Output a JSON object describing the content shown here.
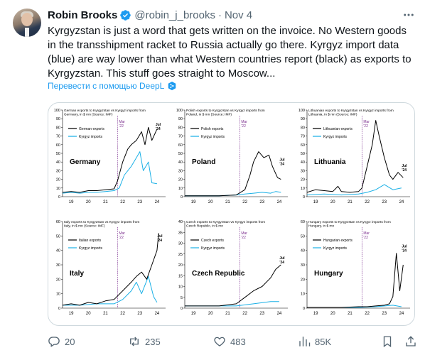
{
  "tweet": {
    "author_name": "Robin Brooks",
    "handle": "@robin_j_brooks",
    "separator": "·",
    "date": "Nov 4",
    "text": "Kyrgyzstan is just a word that gets written on the invoice. No Western goods in the transshipment racket to Russia actually go there. Kyrgyz import data (blue) are way lower than what Western countries report (black) as exports to Kyrgyzstan. This stuff goes straight to Moscow...",
    "translate_link": "Перевести с помощью DeepL",
    "stats": {
      "replies": "20",
      "reposts": "235",
      "likes": "483",
      "views": "85K"
    },
    "colors": {
      "verified": "#1d9bf0",
      "link": "#1d9bf0",
      "muted": "#536471",
      "exports_line": "#000000",
      "imports_line": "#1ab0e6",
      "marker_line": "#7b2d8e"
    }
  },
  "chart_data": [
    {
      "type": "line",
      "title": "German exports to Kyrgyzstan vs Kyrgyz imports from Germany, in $ mn (Source: IMF)",
      "country": "Germany",
      "annotation": "Jul '24",
      "marker_label": "Mar '22",
      "ylim": [
        0,
        100
      ],
      "yticks": [
        0,
        10,
        20,
        30,
        40,
        50,
        60,
        70,
        80,
        90,
        100
      ],
      "xlim": [
        19,
        25
      ],
      "xticks": [
        "19",
        "20",
        "21",
        "22",
        "23",
        "24"
      ],
      "series": [
        {
          "name": "German exports",
          "x": [
            19,
            19.5,
            20,
            20.5,
            21,
            21.5,
            22,
            22.2,
            22.5,
            22.8,
            23,
            23.3,
            23.6,
            23.8,
            24,
            24.2,
            24.5
          ],
          "values": [
            5,
            6,
            5,
            7,
            7,
            8,
            9,
            18,
            40,
            55,
            60,
            65,
            75,
            60,
            80,
            65,
            78
          ]
        },
        {
          "name": "Kyrgyz imports",
          "x": [
            19,
            19.5,
            20,
            20.5,
            21,
            21.5,
            22,
            22.3,
            22.6,
            23,
            23.3,
            23.5,
            23.7,
            24,
            24.2,
            24.5
          ],
          "values": [
            4,
            5,
            4,
            5,
            5,
            6,
            7,
            10,
            25,
            35,
            45,
            52,
            30,
            40,
            16,
            15
          ]
        }
      ]
    },
    {
      "type": "line",
      "title": "Polish exports to Kyrgyzstan vs Kyrgyz imports from Poland, in $ mn (Source: IMF)",
      "country": "Poland",
      "annotation": "Jul '24",
      "marker_label": "Mar '22",
      "ylim": [
        0,
        100
      ],
      "yticks": [
        0,
        10,
        20,
        30,
        40,
        50,
        60,
        70,
        80,
        90,
        100
      ],
      "xlim": [
        19,
        25
      ],
      "xticks": [
        "19",
        "20",
        "21",
        "22",
        "23",
        "24"
      ],
      "series": [
        {
          "name": "Polish exports",
          "x": [
            19,
            20,
            21,
            22,
            22.5,
            22.8,
            23,
            23.3,
            23.6,
            23.9,
            24.1,
            24.4,
            24.6
          ],
          "values": [
            1,
            1,
            1,
            2,
            8,
            25,
            40,
            52,
            45,
            48,
            35,
            22,
            20
          ]
        },
        {
          "name": "Kyrgyz imports",
          "x": [
            19,
            20,
            21,
            22,
            22.5,
            23,
            23.5,
            24,
            24.3,
            24.6
          ],
          "values": [
            1,
            1,
            1,
            2,
            3,
            4,
            5,
            4,
            6,
            5
          ]
        }
      ]
    },
    {
      "type": "line",
      "title": "Lithuanian exports to Kyrgyzstan vs Kyrgyz imports from Lithuania, in $ mn (Source: IMF)",
      "country": "Lithuania",
      "annotation": "Jul '24",
      "marker_label": "Mar '22",
      "ylim": [
        0,
        100
      ],
      "yticks": [
        0,
        10,
        20,
        30,
        40,
        50,
        60,
        70,
        80,
        90,
        100
      ],
      "xlim": [
        19,
        25
      ],
      "xticks": [
        "19",
        "20",
        "21",
        "22",
        "23",
        "24"
      ],
      "series": [
        {
          "name": "Lithuanian exports",
          "x": [
            19,
            19.5,
            20,
            20.5,
            20.8,
            21,
            21.5,
            22,
            22.2,
            22.5,
            22.8,
            23,
            23.2,
            23.5,
            23.8,
            24,
            24.3,
            24.6
          ],
          "values": [
            5,
            8,
            7,
            6,
            12,
            6,
            5,
            6,
            10,
            35,
            60,
            88,
            70,
            45,
            25,
            20,
            28,
            22
          ]
        },
        {
          "name": "Kyrgyz imports",
          "x": [
            19,
            20,
            21,
            22,
            22.5,
            23,
            23.5,
            24,
            24.5
          ],
          "values": [
            2,
            3,
            2,
            3,
            5,
            8,
            14,
            8,
            10
          ]
        }
      ]
    },
    {
      "type": "line",
      "title": "Italy exports to Kyrgyzstan vs Kyrgyz imports from Italy, in $ mn (Source: IMF)",
      "country": "Italy",
      "annotation": "Jul '24",
      "marker_label": "Mar '22",
      "ylim": [
        0,
        60
      ],
      "yticks": [
        0,
        10,
        20,
        30,
        40,
        50,
        60
      ],
      "xlim": [
        19,
        25
      ],
      "xticks": [
        "19",
        "20",
        "21",
        "22",
        "23",
        "24"
      ],
      "series": [
        {
          "name": "Italian exports",
          "x": [
            19,
            19.5,
            20,
            20.5,
            21,
            21.5,
            22,
            22.5,
            23,
            23.3,
            23.6,
            23.9,
            24.2,
            24.5,
            24.6
          ],
          "values": [
            2,
            3,
            2,
            4,
            3,
            5,
            6,
            12,
            18,
            22,
            25,
            20,
            30,
            40,
            52
          ]
        },
        {
          "name": "Kyrgyz imports",
          "x": [
            19,
            20,
            21,
            22,
            22.5,
            23,
            23.3,
            23.6,
            24,
            24.3,
            24.5
          ],
          "values": [
            2,
            2,
            3,
            3,
            6,
            12,
            18,
            10,
            22,
            8,
            4
          ]
        }
      ]
    },
    {
      "type": "line",
      "title": "Czech exports to Kyrgyzstan vs Kyrgyz imports from Czech Republic, in $ mn",
      "country": "Czech Republic",
      "annotation": "Jul '24",
      "marker_label": "Mar '22",
      "ylim": [
        0,
        40
      ],
      "yticks": [
        0,
        5,
        10,
        15,
        20,
        25,
        30,
        35,
        40
      ],
      "xlim": [
        19,
        25
      ],
      "xticks": [
        "19",
        "20",
        "21",
        "22",
        "23",
        "24"
      ],
      "series": [
        {
          "name": "Czech exports",
          "x": [
            19,
            20,
            21,
            22,
            22.5,
            23,
            23.5,
            24,
            24.3,
            24.6
          ],
          "values": [
            1,
            1,
            1,
            2,
            5,
            8,
            10,
            14,
            18,
            20
          ]
        },
        {
          "name": "Kyrgyz imports",
          "x": [
            19,
            20,
            21,
            22,
            23,
            24,
            24.5
          ],
          "values": [
            1,
            1,
            1,
            1,
            2,
            3,
            3
          ]
        }
      ]
    },
    {
      "type": "line",
      "title": "Hungary exports to Kyrgyzstan vs Kyrgyz imports from Hungary, in $ mn",
      "country": "Hungary",
      "annotation": "Jul '24",
      "marker_label": "Mar '22",
      "ylim": [
        0,
        60
      ],
      "yticks": [
        0,
        10,
        20,
        30,
        40,
        50,
        60
      ],
      "xlim": [
        19,
        25
      ],
      "xticks": [
        "19",
        "20",
        "21",
        "22",
        "23",
        "24"
      ],
      "series": [
        {
          "name": "Hungarian exports",
          "x": [
            19,
            20,
            21,
            22,
            22.5,
            23,
            23.5,
            23.8,
            24,
            24.2,
            24.4,
            24.6
          ],
          "values": [
            0.5,
            0.5,
            0.5,
            1,
            1,
            1.5,
            2,
            3,
            8,
            38,
            12,
            30
          ]
        },
        {
          "name": "Kyrgyz imports",
          "x": [
            19,
            20,
            21,
            22,
            23,
            24,
            24.5
          ],
          "values": [
            0.5,
            0.5,
            0.5,
            0.5,
            1,
            2,
            1
          ]
        }
      ]
    }
  ]
}
